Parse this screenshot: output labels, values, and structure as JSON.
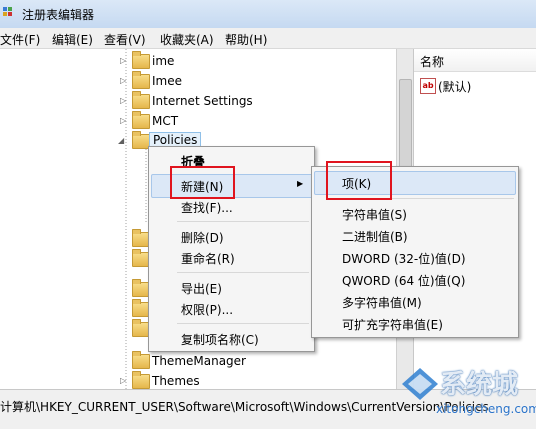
{
  "window": {
    "title": "注册表编辑器"
  },
  "menu": [
    "文件(F)",
    "编辑(E)",
    "查看(V)",
    "收藏夹(A)",
    "帮助(H)"
  ],
  "tree": {
    "items": [
      {
        "label": "ime",
        "expander": "▷"
      },
      {
        "label": "Imee",
        "expander": "▷"
      },
      {
        "label": "Internet Settings",
        "expander": "▷"
      },
      {
        "label": "MCT",
        "expander": "▷"
      },
      {
        "label": "Policies",
        "expander": "◢",
        "selected": true
      },
      {
        "label": "ThemeManager",
        "expander": ""
      },
      {
        "label": "Themes",
        "expander": "▷"
      }
    ]
  },
  "right_pane": {
    "column_header": "名称",
    "value_icon": "ab",
    "value_name": "(默认)"
  },
  "context_menu": {
    "items": [
      "折叠",
      "新建(N)",
      "查找(F)...",
      "删除(D)",
      "重命名(R)",
      "导出(E)",
      "权限(P)...",
      "复制项名称(C)"
    ],
    "highlighted": "新建(N)"
  },
  "submenu": {
    "items": [
      "项(K)",
      "字符串值(S)",
      "二进制值(B)",
      "DWORD (32-位)值(D)",
      "QWORD (64 位)值(Q)",
      "多字符串值(M)",
      "可扩充字符串值(E)"
    ],
    "highlighted": "项(K)"
  },
  "status_bar": {
    "path": "计算机\\HKEY_CURRENT_USER\\Software\\Microsoft\\Windows\\CurrentVersion\\Policies"
  },
  "watermark": {
    "logo_text": "系统城",
    "url": "xitongcheng.com"
  },
  "colors": {
    "highlight_box": "#e0141e",
    "menu_hover": "#dce8f7",
    "folder": "#e5b64c"
  }
}
